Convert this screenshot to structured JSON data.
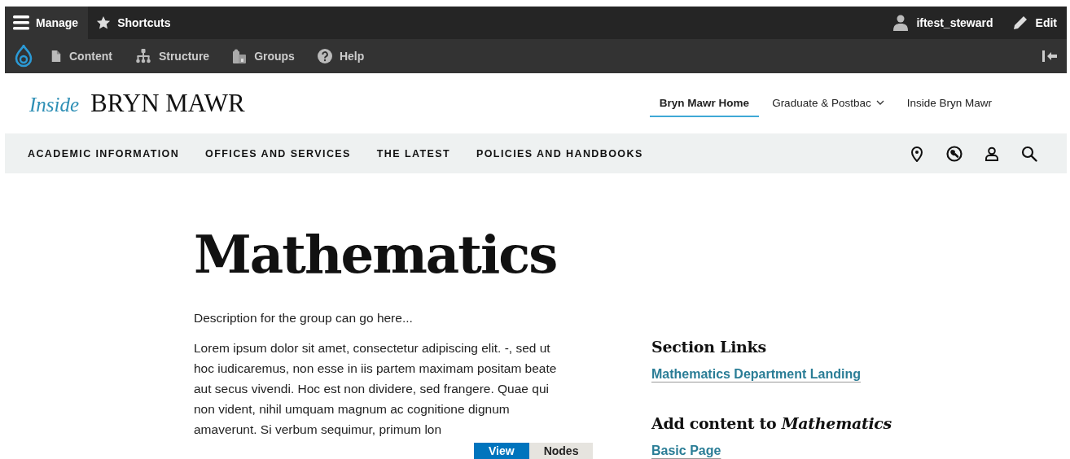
{
  "toolbar": {
    "bar_items": [
      {
        "kind": "menu",
        "label": "Manage",
        "selected": true
      },
      {
        "kind": "star",
        "label": "Shortcuts",
        "selected": false
      }
    ],
    "user": "iftest_steward",
    "edit": "Edit",
    "tray_items": [
      {
        "kind": "page",
        "label": "Content"
      },
      {
        "kind": "tree",
        "label": "Structure"
      },
      {
        "kind": "groups",
        "label": "Groups"
      },
      {
        "kind": "help",
        "label": "Help"
      }
    ]
  },
  "header": {
    "logo": {
      "prefix": "Inside",
      "name": "BRYN MAWR"
    },
    "links": [
      {
        "label": "Bryn Mawr Home",
        "selected": true,
        "has_menu": false
      },
      {
        "label": "Graduate & Postbac",
        "selected": false,
        "has_menu": true
      },
      {
        "label": "Inside Bryn Mawr",
        "selected": false,
        "has_menu": false
      }
    ]
  },
  "nav": {
    "items": [
      "ACADEMIC INFORMATION",
      "OFFICES AND SERVICES",
      "THE LATEST",
      "POLICIES AND HANDBOOKS"
    ],
    "tools": [
      {
        "kind": "pin"
      },
      {
        "kind": "wrench"
      },
      {
        "kind": "person"
      },
      {
        "kind": "search"
      }
    ]
  },
  "main": {
    "title": "Mathematics",
    "description": "Description for the group can go here...",
    "paragraph_lines": [
      "Lorem ipsum dolor sit amet, consectetur adipiscing elit. -, sed ut",
      "hoc iudicaremus, non esse in iis partem maximam positam beate",
      "aut secus vivendi. Hoc est non dividere, sed frangere. Quae qui",
      "non vident, nihil umquam magnum ac cognitione dignum",
      "amaverunt. Si verbum sequimur, primum lon"
    ],
    "tabs": [
      {
        "label": "View",
        "selected": true
      },
      {
        "label": "Nodes",
        "selected": false
      }
    ]
  },
  "sidebar": {
    "sections": [
      {
        "heading": "Section Links",
        "links": [
          "Mathematics Department Landing"
        ]
      },
      {
        "heading": "Add content to *Mathematics*",
        "links": [
          "Basic Page"
        ]
      }
    ]
  }
}
